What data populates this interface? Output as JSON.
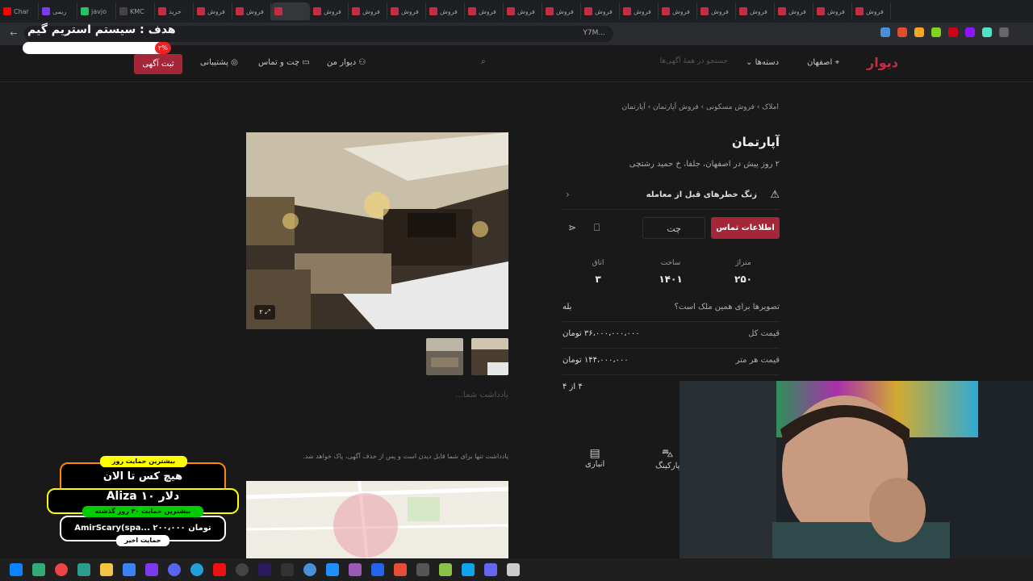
{
  "browser": {
    "tabs": [
      {
        "label": "Char",
        "color": "#ff0000",
        "active": false
      },
      {
        "label": "ریمی",
        "color": "#7c3aed",
        "active": false
      },
      {
        "label": "javjo",
        "color": "#22c55e",
        "active": false
      },
      {
        "label": "KMC",
        "color": "#444444",
        "active": false
      },
      {
        "label": "خرید",
        "color": "#c62c44",
        "active": false
      },
      {
        "label": "فروش",
        "color": "#c62c44",
        "active": false
      },
      {
        "label": "فروش",
        "color": "#c62c44",
        "active": false
      },
      {
        "label": "",
        "color": "#c62c44",
        "active": true
      },
      {
        "label": "فروش",
        "color": "#c62c44",
        "active": false
      },
      {
        "label": "فروش",
        "color": "#c62c44",
        "active": false
      },
      {
        "label": "فروش",
        "color": "#c62c44",
        "active": false
      },
      {
        "label": "فروش",
        "color": "#c62c44",
        "active": false
      },
      {
        "label": "فروش",
        "color": "#c62c44",
        "active": false
      },
      {
        "label": "فروش",
        "color": "#c62c44",
        "active": false
      },
      {
        "label": "فروش",
        "color": "#c62c44",
        "active": false
      },
      {
        "label": "فروش",
        "color": "#c62c44",
        "active": false
      },
      {
        "label": "فروش",
        "color": "#c62c44",
        "active": false
      },
      {
        "label": "فروش",
        "color": "#c62c44",
        "active": false
      },
      {
        "label": "فروش",
        "color": "#c62c44",
        "active": false
      },
      {
        "label": "فروش",
        "color": "#c62c44",
        "active": false
      },
      {
        "label": "فروش",
        "color": "#c62c44",
        "active": false
      },
      {
        "label": "فروش",
        "color": "#c62c44",
        "active": false
      },
      {
        "label": "فروش",
        "color": "#c62c44",
        "active": false
      }
    ],
    "address": "...Y7M"
  },
  "header": {
    "logo": "دیوار",
    "city": "اصفهان",
    "categories": "دسته‌ها",
    "search_placeholder": "جستجو در همهٔ آگهی‌ها",
    "my_divar": "دیوار من",
    "chat": "چت و تماس",
    "support": "پشتیبانی",
    "post_ad": "ثبت آگهی"
  },
  "listing": {
    "breadcrumb": [
      "املاک",
      "فروش مسکونی",
      "فروش آپارتمان",
      "آپارتمان"
    ],
    "title": "آپارتمان",
    "subtitle": "۲ روز پیش در اصفهان، جلفا، خ حمید رشتچی",
    "alert": "زنگ خطرهای قبل از معامله",
    "contact_button": "اطلاعات تماس",
    "chat_button": "چت",
    "stats": [
      {
        "label": "متراژ",
        "value": "۲۵۰"
      },
      {
        "label": "ساخت",
        "value": "۱۴۰۱"
      },
      {
        "label": "اتاق",
        "value": "۳"
      }
    ],
    "rows": [
      {
        "key": "تصویرها برای همین ملک است؟",
        "value": "بله"
      },
      {
        "key": "قیمت کل",
        "value": "۳۶،۰۰۰،۰۰۰،۰۰۰ تومان"
      },
      {
        "key": "قیمت هر متر",
        "value": "۱۴۴،۰۰۰،۰۰۰ تومان"
      },
      {
        "key": "",
        "value": "۴ از ۴"
      }
    ],
    "image_count": "۲",
    "note_placeholder": "یادداشت شما...",
    "note_hint": "یادداشت تنها برای شما قابل دیدن است و پس از حذف آگهی، پاک خواهد شد.",
    "features": [
      "انباری",
      "پارکینگ"
    ]
  },
  "overlay": {
    "goal": "هدف : سیستم استریم گیم",
    "percent": "۲%",
    "donor_title": "بیشترین حمایت روز",
    "donor_line1": "هیچ کس تا الان",
    "donor_line2": "Aliza  ۱۰ دلار",
    "donor_title2": "بیشترین حمایت ۳۰ روز گذشته",
    "donor_line3": "AmirScary(spa...  ۲۰۰،۰۰۰ تومان",
    "donor_title3": "حمایت اخیر"
  }
}
